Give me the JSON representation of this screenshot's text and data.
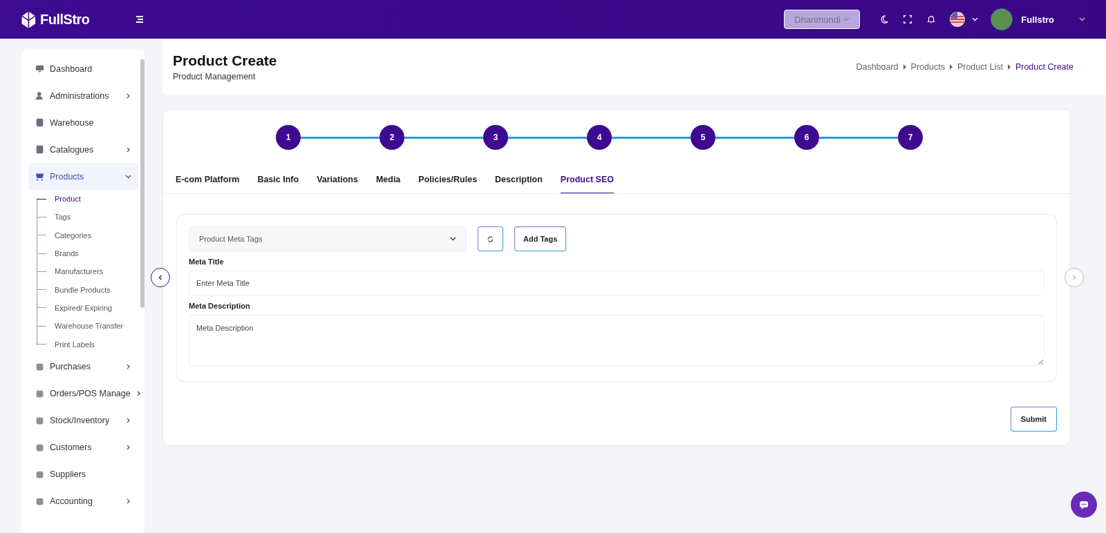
{
  "topbar": {
    "logo_text": "FullStro",
    "branch": "Dhanmondi",
    "user_name": "Fullstro"
  },
  "sidebar": {
    "items": [
      {
        "label": "Dashboard",
        "has_submenu": false,
        "expanded": false,
        "selected": false
      },
      {
        "label": "Administrations",
        "has_submenu": true,
        "expanded": false,
        "selected": false
      },
      {
        "label": "Warehouse",
        "has_submenu": false,
        "expanded": false,
        "selected": false
      },
      {
        "label": "Catalogues",
        "has_submenu": true,
        "expanded": false,
        "selected": false
      },
      {
        "label": "Products",
        "has_submenu": true,
        "expanded": true,
        "selected": true,
        "children": [
          {
            "label": "Product",
            "selected": true
          },
          {
            "label": "Tags",
            "selected": false
          },
          {
            "label": "Categories",
            "selected": false
          },
          {
            "label": "Brands",
            "selected": false
          },
          {
            "label": "Manufacturers",
            "selected": false
          },
          {
            "label": "Bundle Products",
            "selected": false
          },
          {
            "label": "Expired/ Expiring",
            "selected": false
          },
          {
            "label": "Warehouse Transfer",
            "selected": false
          },
          {
            "label": "Print Labels",
            "selected": false
          }
        ]
      },
      {
        "label": "Purchases",
        "has_submenu": true,
        "expanded": false,
        "selected": false
      },
      {
        "label": "Orders/POS Manage",
        "has_submenu": true,
        "expanded": false,
        "selected": false
      },
      {
        "label": "Stock/Inventory",
        "has_submenu": true,
        "expanded": false,
        "selected": false
      },
      {
        "label": "Customers",
        "has_submenu": true,
        "expanded": false,
        "selected": false
      },
      {
        "label": "Suppliers",
        "has_submenu": false,
        "expanded": false,
        "selected": false
      },
      {
        "label": "Accounting",
        "has_submenu": true,
        "expanded": false,
        "selected": false
      }
    ]
  },
  "page_header": {
    "title": "Product Create",
    "subtitle": "Product Management",
    "breadcrumbs": [
      {
        "label": "Dashboard",
        "selected": false
      },
      {
        "label": "Products",
        "selected": false
      },
      {
        "label": "Product List",
        "selected": false
      },
      {
        "label": "Product Create",
        "selected": true
      }
    ]
  },
  "stepper": {
    "steps": [
      "1",
      "2",
      "3",
      "4",
      "5",
      "6",
      "7"
    ]
  },
  "tabs": [
    {
      "label": "E-com Platform",
      "selected": false
    },
    {
      "label": "Basic Info",
      "selected": false
    },
    {
      "label": "Variations",
      "selected": false
    },
    {
      "label": "Media",
      "selected": false
    },
    {
      "label": "Policies/Rules",
      "selected": false
    },
    {
      "label": "Description",
      "selected": false
    },
    {
      "label": "Product SEO",
      "selected": true
    }
  ],
  "form": {
    "meta_tags_placeholder": "Product Meta Tags",
    "add_tags_button": "Add Tags",
    "meta_title_label": "Meta Title",
    "meta_title_placeholder": "Enter Meta Title",
    "meta_description_label": "Meta Description",
    "meta_description_placeholder": "Meta Description",
    "submit_button": "Submit"
  },
  "nav": {
    "prev_disabled": false,
    "next_disabled": true
  }
}
